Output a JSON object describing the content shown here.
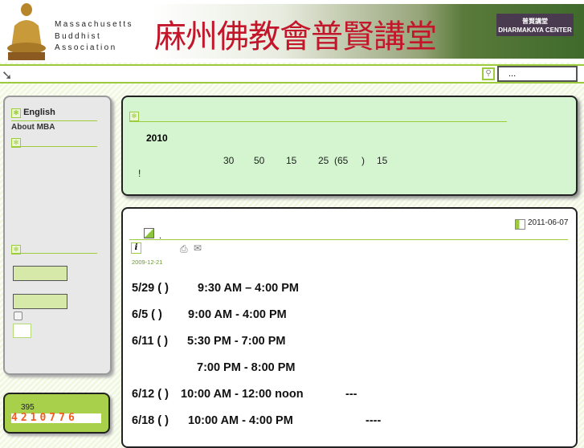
{
  "header": {
    "org_lines": [
      "Massachusetts",
      "Buddhist",
      "Association"
    ],
    "chinese_title": "麻州佛教會普賢講堂",
    "sign_text_cn": "普賢講堂",
    "sign_text_en": "DHARMAKAYA CENTER"
  },
  "toolbar": {
    "search_value": "..."
  },
  "sidebar": {
    "english_label": "English",
    "about_label": "About MBA"
  },
  "counter": {
    "label": "395",
    "digits": "4210776"
  },
  "notice": {
    "year": "2010",
    "numbers": [
      "30",
      "50",
      "15",
      "25",
      "(65",
      ")",
      "15"
    ],
    "exclaim": "!"
  },
  "article": {
    "date": "2011-06-07",
    "dot": ".",
    "post_date": "2009-12-21",
    "schedule": [
      {
        "date": "5/29 (  )",
        "time": "9:30 AM – 4:00 PM",
        "extra": ""
      },
      {
        "date": "6/5 (  )",
        "time": "9:00 AM - 4:00 PM",
        "extra": ""
      },
      {
        "date": "6/11 (  )",
        "time": "5:30 PM - 7:00 PM",
        "extra": ""
      },
      {
        "date": "",
        "time": "7:00 PM - 8:00 PM",
        "extra": ""
      },
      {
        "date": "6/12 (  )",
        "time": "10:00 AM - 12:00 noon",
        "extra": "---"
      },
      {
        "date": "6/18 (  )",
        "time": "10:00 AM - 4:00 PM",
        "extra": "----"
      }
    ]
  },
  "colors": {
    "accent": "#9ccb3b",
    "title_red": "#c3162b",
    "notice_bg": "#d4f5d0",
    "counter_bg": "#a8d04a"
  }
}
